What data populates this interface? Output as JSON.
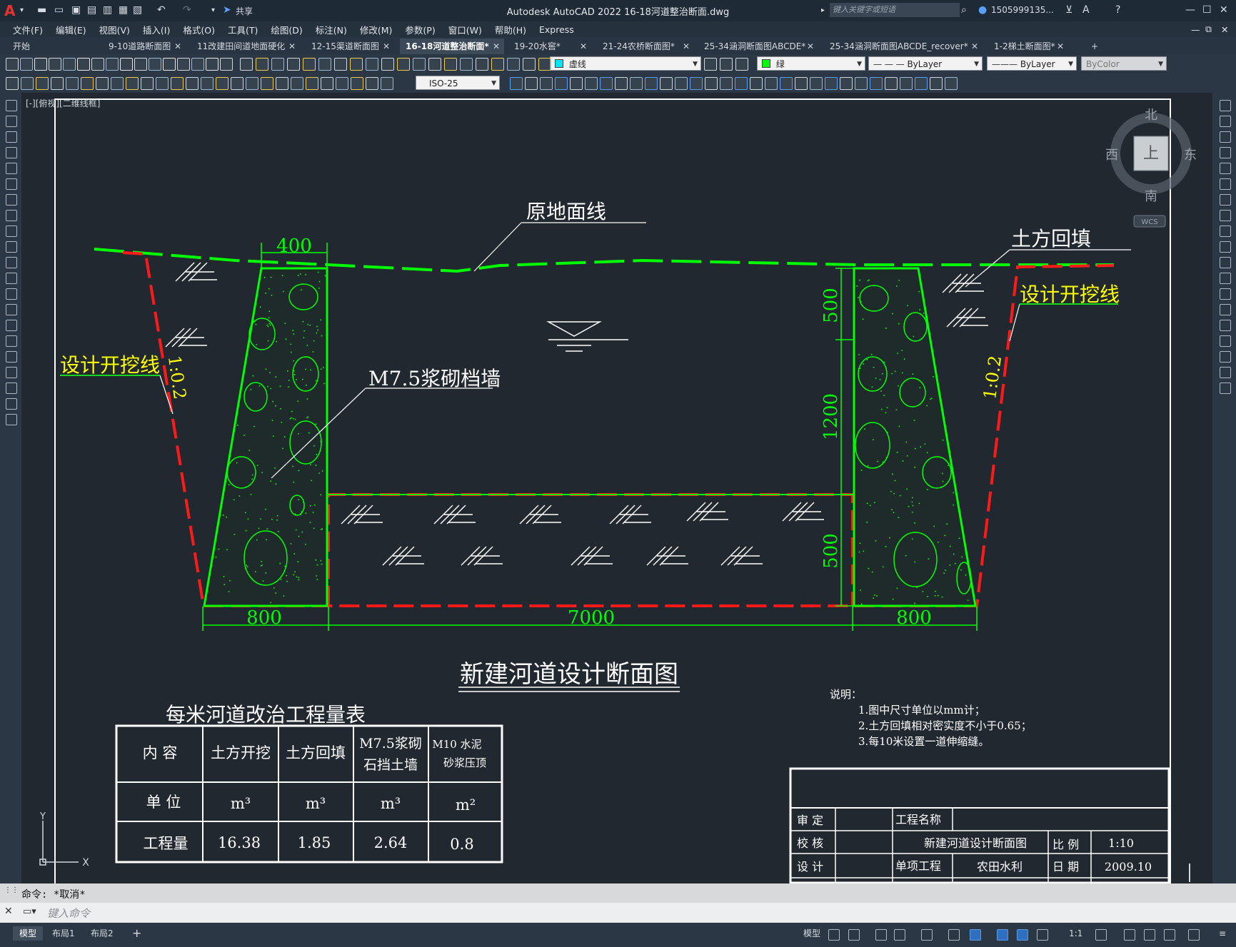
{
  "app": {
    "title": "Autodesk AutoCAD 2022    16-18河道整治断面.dwg",
    "logo": "A",
    "share": "共享",
    "search_placeholder": "键入关键字或短语",
    "user": "1505999135...",
    "viewport_label": "[-][俯视][二维线框]"
  },
  "menu": [
    "文件(F)",
    "编辑(E)",
    "视图(V)",
    "插入(I)",
    "格式(O)",
    "工具(T)",
    "绘图(D)",
    "标注(N)",
    "修改(M)",
    "参数(P)",
    "窗口(W)",
    "帮助(H)",
    "Express"
  ],
  "tabs": [
    {
      "label": "开始",
      "active": false,
      "closable": false
    },
    {
      "label": "9-10道路断面图",
      "active": false,
      "closable": true
    },
    {
      "label": "11改建田间道地面硬化",
      "active": false,
      "closable": true
    },
    {
      "label": "12-15渠道断面图",
      "active": false,
      "closable": true
    },
    {
      "label": "16-18河道整治断面*",
      "active": true,
      "closable": true
    },
    {
      "label": "19-20水窖*",
      "active": false,
      "closable": true
    },
    {
      "label": "21-24农桥断面图*",
      "active": false,
      "closable": true
    },
    {
      "label": "25-34涵洞断面图ABCDE*",
      "active": false,
      "closable": true
    },
    {
      "label": "25-34涵洞断面图ABCDE_recover*",
      "active": false,
      "closable": true
    },
    {
      "label": "1-2梯土断面图*",
      "active": false,
      "closable": true
    }
  ],
  "toolbar": {
    "layer": "虚线",
    "color": "绿",
    "linetype": "ByLayer",
    "lineweight": "ByLayer",
    "plotstyle": "ByColor",
    "dimstyle": "ISO-25"
  },
  "viewcube": {
    "north": "北",
    "south": "南",
    "east": "东",
    "west": "西",
    "top": "上",
    "wcs": "WCS"
  },
  "drawing": {
    "labels": {
      "original_ground": "原地面线",
      "backfill": "土方回填",
      "excavation_left": "设计开挖线",
      "excavation_right": "设计开挖线",
      "wall": "M7.5浆砌档墙",
      "slope_left": "1:0.2",
      "slope_right": "1:0.2"
    },
    "dims": {
      "top_width": "400",
      "base_left": "800",
      "channel": "7000",
      "base_right": "800",
      "h_top": "500",
      "h_mid": "1200",
      "h_bottom": "500"
    },
    "section_title": "新建河道设计断面图",
    "notes": {
      "title": "说明：",
      "items": [
        "1.图中尺寸单位以mm计；",
        "2.土方回填相对密实度不小于0.65；",
        "3.每10米设置一道伸缩缝。"
      ]
    },
    "quantity_table": {
      "title": "每米河道改治工程量表",
      "headers": [
        "内  容",
        "土方开挖",
        "土方回填",
        "M7.5浆砌|石挡土墙",
        "M10 水泥|砂浆压顶"
      ],
      "units_label": "单  位",
      "units": [
        "m³",
        "m³",
        "m³",
        "m²"
      ],
      "qty_label": "工程量",
      "quantities": [
        "16.38",
        "1.85",
        "2.64",
        "0.8"
      ]
    },
    "title_block": {
      "approve": "审  定",
      "project_name_label": "工程名称",
      "check": "校  核",
      "drawing_name": "新建河道设计断面图",
      "scale_label": "比  例",
      "scale": "1:10",
      "design": "设  计",
      "sub_project_label": "单项工程",
      "sub_project": "农田水利",
      "date_label": "日  期",
      "date": "2009.10"
    },
    "ucs": {
      "x": "X",
      "y": "Y"
    }
  },
  "command": {
    "last": "命令: *取消*",
    "placeholder": "键入命令"
  },
  "layouts": [
    "模型",
    "布局1",
    "布局2"
  ],
  "status": {
    "model": "模型",
    "scale": "1:1"
  },
  "colors": {
    "accent": "#2f6fbf",
    "cad_green": "#00ff00",
    "cad_red": "#ff1a1a",
    "cad_yellow": "#ffff00",
    "dark_bg": "#212830"
  }
}
